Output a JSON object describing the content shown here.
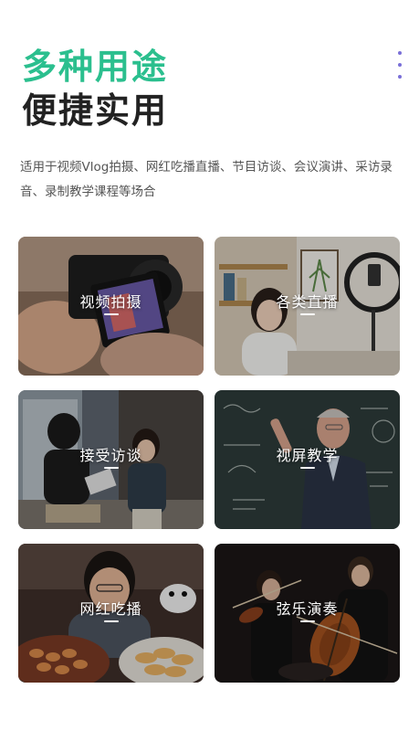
{
  "header": {
    "title_accent": "多种用途",
    "title_main": "便捷实用",
    "more_icon": "more-vertical-icon"
  },
  "description": "适用于视频Vlog拍摄、网红吃播直播、节目访谈、会议演讲、采访录音、录制教学课程等场合",
  "colors": {
    "accent": "#2bbf8e",
    "title": "#222222",
    "text": "#555555",
    "more_dots": "#7a6fd8"
  },
  "scenarios": [
    {
      "label": "视频拍摄"
    },
    {
      "label": "各类直播"
    },
    {
      "label": "接受访谈"
    },
    {
      "label": "视屏教学"
    },
    {
      "label": "网红吃播"
    },
    {
      "label": "弦乐演奏"
    }
  ]
}
